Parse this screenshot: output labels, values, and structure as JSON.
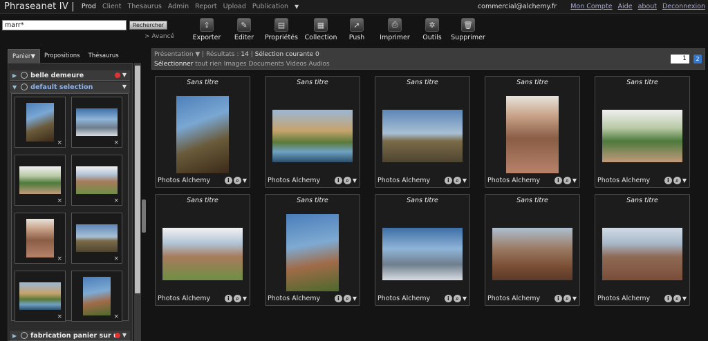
{
  "app": {
    "brand": "Phraseanet IV |"
  },
  "topnav": [
    {
      "label": "Prod",
      "active": true
    },
    {
      "label": "Client"
    },
    {
      "label": "Thesaurus"
    },
    {
      "label": "Admin"
    },
    {
      "label": "Report"
    },
    {
      "label": "Upload"
    },
    {
      "label": "Publication"
    }
  ],
  "account": {
    "user": "commercial@alchemy.fr",
    "links": [
      "Mon Compte",
      "Aide",
      "about",
      "Deconnexion"
    ]
  },
  "search": {
    "value": "marr*",
    "button": "Rechercher",
    "advanced": "> Avancé"
  },
  "toolbar": [
    {
      "label": "Exporter",
      "icon": "export-icon"
    },
    {
      "label": "Editer",
      "icon": "edit-icon"
    },
    {
      "label": "Propriétés",
      "icon": "properties-icon"
    },
    {
      "label": "Collection",
      "icon": "collection-icon"
    },
    {
      "label": "Push",
      "icon": "push-icon"
    },
    {
      "label": "Imprimer",
      "icon": "print-icon"
    },
    {
      "label": "Outils",
      "icon": "tools-icon"
    },
    {
      "label": "Supprimer",
      "icon": "delete-icon"
    }
  ],
  "left_tabs": [
    "Panier",
    "Propositions",
    "Thésaurus"
  ],
  "baskets": [
    {
      "name": "belle demeure",
      "open": false
    },
    {
      "name": "default selection",
      "open": true
    },
    {
      "name": "fabrication panier sur u",
      "open": false
    }
  ],
  "basket_items": [
    "p-palm",
    "p-wing",
    "p-garden",
    "p-ruin",
    "p-stair",
    "p-land",
    "p-pool",
    "p-palm2"
  ],
  "results": {
    "presentation": "Présentation",
    "results_label": "Résultats :",
    "results_count": "14",
    "selection_label": "Sélection courante",
    "selection_count": "0",
    "select_label": "Sélectionner",
    "select_options": "tout rien Images Documents Videos Audios",
    "page": "1",
    "next_page": "2"
  },
  "cards": [
    {
      "title": "Sans titre",
      "collection": "Photos Alchemy",
      "photo": "p-palm"
    },
    {
      "title": "Sans titre",
      "collection": "Photos Alchemy",
      "photo": "p-pool"
    },
    {
      "title": "Sans titre",
      "collection": "Photos Alchemy",
      "photo": "p-land"
    },
    {
      "title": "Sans titre",
      "collection": "Photos Alchemy",
      "photo": "p-stair"
    },
    {
      "title": "Sans titre",
      "collection": "Photos Alchemy",
      "photo": "p-garden"
    },
    {
      "title": "Sans titre",
      "collection": "Photos Alchemy",
      "photo": "p-ruin"
    },
    {
      "title": "Sans titre",
      "collection": "Photos Alchemy",
      "photo": "p-palm2"
    },
    {
      "title": "Sans titre",
      "collection": "Photos Alchemy",
      "photo": "p-wing"
    },
    {
      "title": "Sans titre",
      "collection": "Photos Alchemy",
      "photo": "p-mount"
    },
    {
      "title": "Sans titre",
      "collection": "Photos Alchemy",
      "photo": "p-mount2"
    }
  ]
}
